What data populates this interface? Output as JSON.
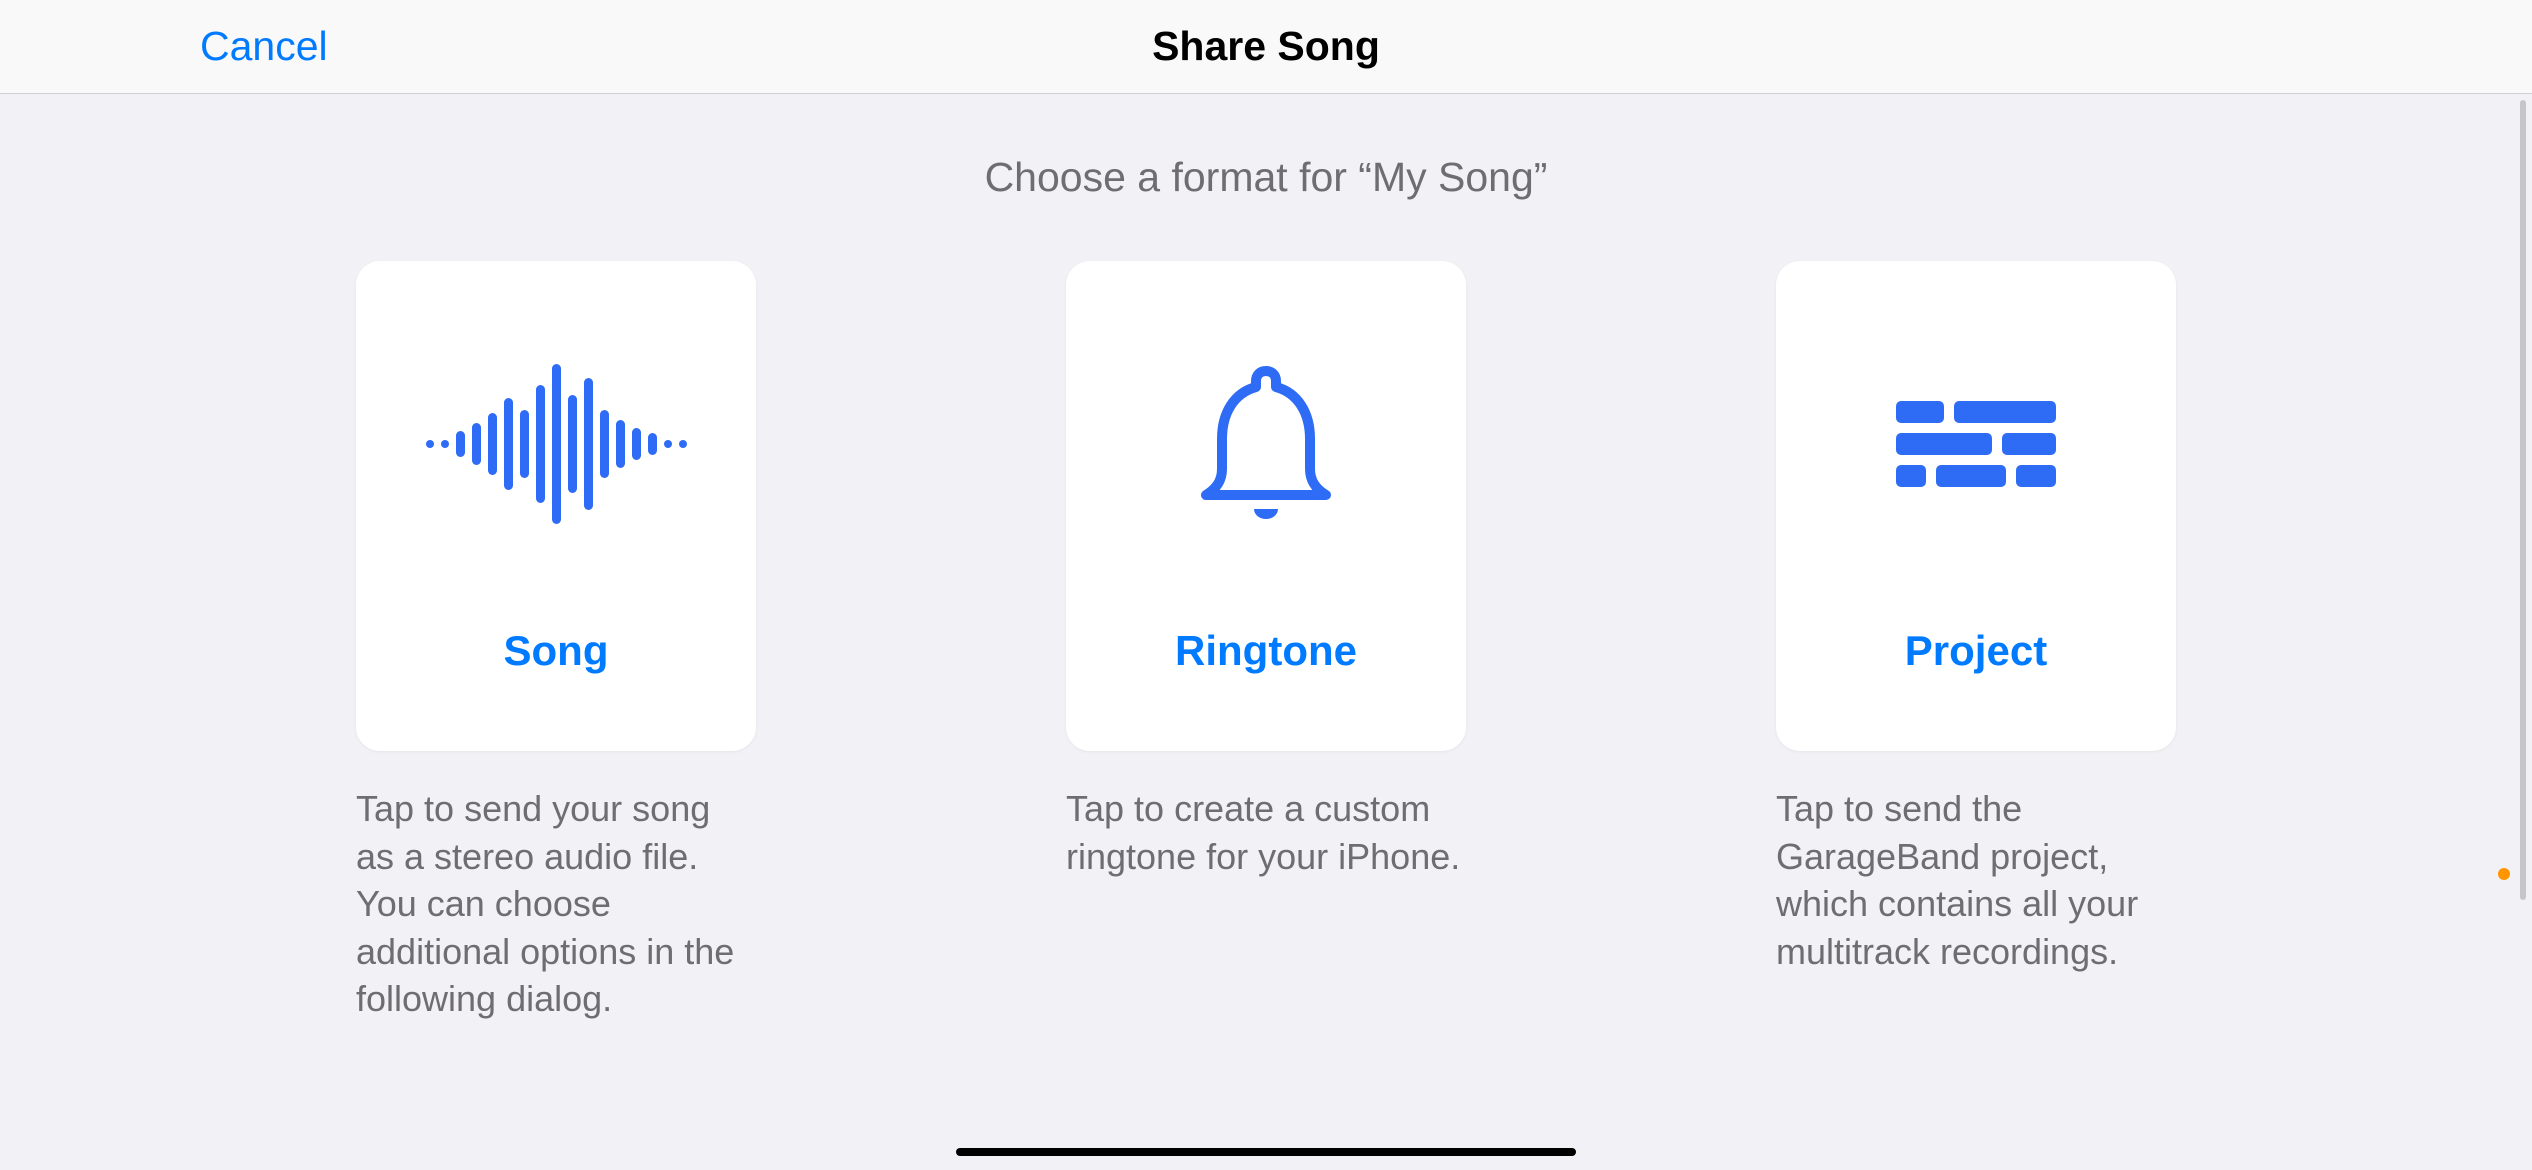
{
  "header": {
    "cancel": "Cancel",
    "title": "Share Song"
  },
  "subtitle": "Choose a format for “My Song”",
  "options": {
    "song": {
      "label": "Song",
      "description": "Tap to send your song as a stereo audio file. You can choose additional options in the following dialog."
    },
    "ringtone": {
      "label": "Ringtone",
      "description": "Tap to create a custom ringtone for your iPhone."
    },
    "project": {
      "label": "Project",
      "description": "Tap to send the GarageBand project, which contains all your multitrack recordings."
    }
  }
}
